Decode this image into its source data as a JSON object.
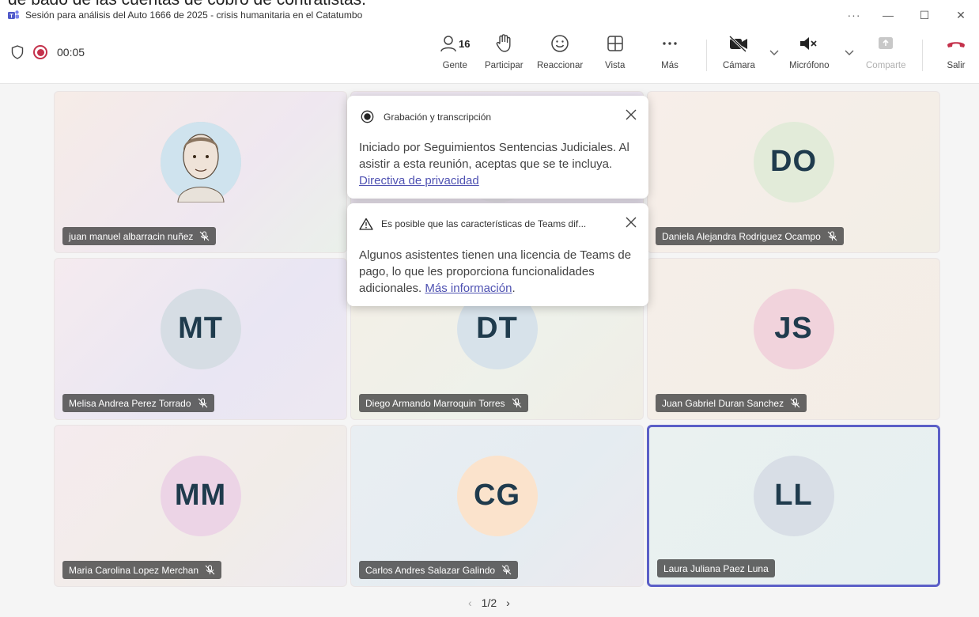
{
  "document_text": "de pago de las cuentas de cobro de contratistas.",
  "window": {
    "title": "Sesión para análisis del Auto 1666 de 2025 - crisis humanitaria en el Catatumbo",
    "more_label": "···",
    "minimize_label": "—",
    "maximize_label": "☐",
    "close_label": "✕"
  },
  "toolbar": {
    "timer": "00:05",
    "people_count": "16",
    "buttons": {
      "people": "Gente",
      "participate": "Participar",
      "react": "Reaccionar",
      "view": "Vista",
      "more": "Más",
      "camera": "Cámara",
      "mic": "Micrófono",
      "share": "Comparte",
      "leave": "Salir"
    }
  },
  "popups": {
    "recording": {
      "title": "Grabación y transcripción",
      "body": "Iniciado por Seguimientos Sentencias Judiciales. Al asistir a esta reunión, aceptas que se te incluya.",
      "link": "Directiva de privacidad"
    },
    "license": {
      "title": "Es posible que las características de Teams dif...",
      "body": "Algunos asistentes tienen una licencia de Teams de pago, lo que les proporciona funcionalidades adicionales.",
      "link": "Más información",
      "suffix": "."
    }
  },
  "participants": [
    {
      "name": "juan manuel albarracin nuñez",
      "initials": "",
      "muted": true,
      "avatar_bg": "#d8cfc6",
      "photo": true
    },
    {
      "name": "",
      "initials": "",
      "muted": false,
      "avatar_bg": "#e8e4ec",
      "photo": false
    },
    {
      "name": "Daniela Alejandra Rodriguez Ocampo",
      "initials": "DO",
      "muted": true,
      "avatar_bg": "#e2ebd9"
    },
    {
      "name": "Melisa Andrea Perez Torrado",
      "initials": "MT",
      "muted": true,
      "avatar_bg": "#d6dde4"
    },
    {
      "name": "Diego Armando Marroquin Torres",
      "initials": "DT",
      "muted": true,
      "avatar_bg": "#d7e2ea"
    },
    {
      "name": "Juan Gabriel Duran Sanchez",
      "initials": "JS",
      "muted": true,
      "avatar_bg": "#f1d3dc"
    },
    {
      "name": "Maria Carolina Lopez Merchan",
      "initials": "MM",
      "muted": true,
      "avatar_bg": "#ecd4e6"
    },
    {
      "name": "Carlos Andres Salazar Galindo",
      "initials": "CG",
      "muted": true,
      "avatar_bg": "#fbe3cc"
    },
    {
      "name": "Laura Juliana Paez Luna",
      "initials": "LL",
      "muted": false,
      "avatar_bg": "#d8dee6"
    }
  ],
  "pager": {
    "label": "1/2",
    "prev": "‹",
    "next": "›"
  },
  "colors": {
    "accent": "#5b5fc7",
    "record": "#c4314b",
    "leave": "#c4314b",
    "link": "#4f52b2"
  }
}
